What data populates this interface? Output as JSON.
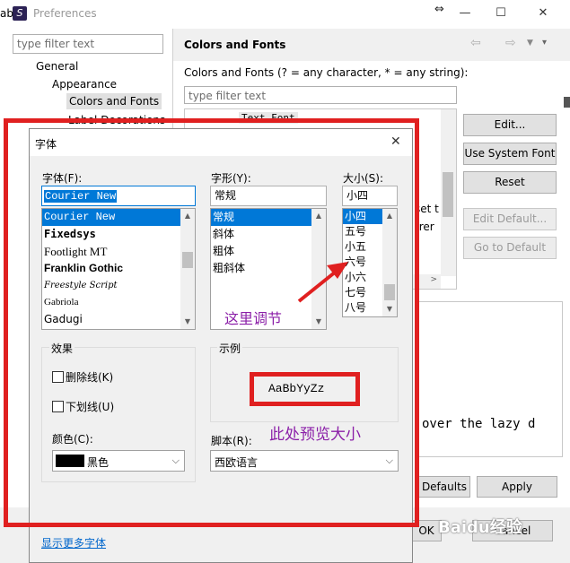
{
  "pref": {
    "title": "Preferences",
    "title_fragment": "ab",
    "filter_placeholder": "type filter text",
    "tree": [
      "General",
      "Appearance",
      "Colors and Fonts",
      "Label Decorations"
    ],
    "section_title": "Colors and Fonts",
    "description": "Colors and Fonts (? = any character, * = any string):",
    "filter2_placeholder": "type filter text",
    "list_item_text_font": "Text Font",
    "edit_button": "Edit...",
    "use_system_font_button": "Use System Font",
    "reset_button": "Reset",
    "edit_default_button": "Edit Default...",
    "goto_default_button": "Go to Default",
    "partial_right1": "set t",
    "partial_right2": "rrer",
    "preview_text": "over the lazy d",
    "defaults_button": "Defaults",
    "apply_button": "Apply",
    "ok_button": "OK",
    "cancel_button": "Cancel"
  },
  "font_dialog": {
    "title": "字体",
    "close_symbol": "✕",
    "font_label": "字体(F):",
    "font_value": "Courier New",
    "fonts": [
      "Courier New",
      "Fixedsys",
      "Footlight MT",
      "Franklin Gothic",
      "Freestyle Script",
      "Gabriola",
      "Gadugi"
    ],
    "style_label": "字形(Y):",
    "style_value": "常规",
    "styles": [
      "常规",
      "斜体",
      "粗体",
      "粗斜体"
    ],
    "size_label": "大小(S):",
    "size_value": "小四",
    "sizes": [
      "小四",
      "五号",
      "小五",
      "六号",
      "小六",
      "七号",
      "八号"
    ],
    "effects_label": "效果",
    "strikeout_label": "删除线(K)",
    "underline_label": "下划线(U)",
    "color_label": "颜色(C):",
    "color_value": "黑色",
    "sample_label": "示例",
    "sample_text": "AaBbYyZz",
    "script_label": "脚本(R):",
    "script_value": "西欧语言",
    "more_fonts_link": "显示更多字体"
  },
  "annotations": {
    "adjust_here": "这里调节",
    "preview_size": "此处预览大小"
  },
  "watermark": "Baidu经验",
  "colors": {
    "highlight": "#0078d7",
    "annotation_red": "#e02020",
    "annotation_purple": "#8b1fa8",
    "link": "#0066cc"
  }
}
